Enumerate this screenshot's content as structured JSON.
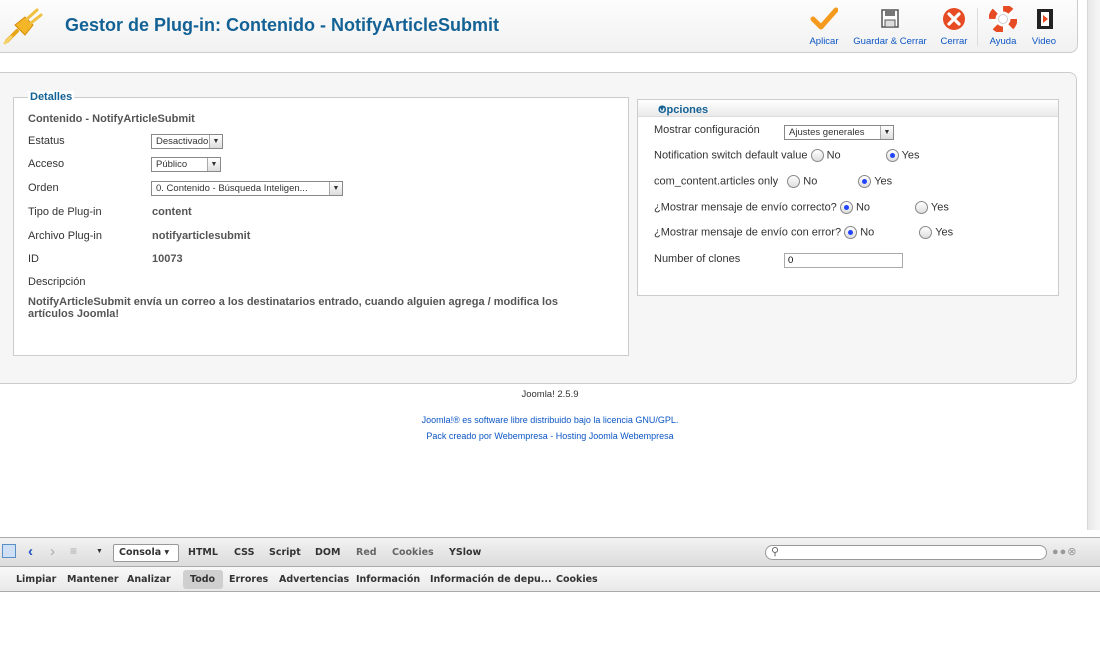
{
  "header": {
    "title": "Gestor de Plug-in: Contenido - NotifyArticleSubmit",
    "buttons": {
      "apply": "Aplicar",
      "save_close": "Guardar & Cerrar",
      "close": "Cerrar",
      "help": "Ayuda",
      "video": "Video"
    },
    "icons": {
      "logo": "plug-icon",
      "apply": "checkmark-icon",
      "save_close": "floppy-disk-icon",
      "close": "close-x-icon",
      "help": "lifebuoy-icon",
      "video": "film-icon"
    }
  },
  "details": {
    "legend": "Detalles",
    "subtitle": "Contenido - NotifyArticleSubmit",
    "status": {
      "label": "Estatus",
      "value": "Desactivado"
    },
    "access": {
      "label": "Acceso",
      "value": "Público"
    },
    "order": {
      "label": "Orden",
      "value": "0. Contenido - Búsqueda Inteligen..."
    },
    "type": {
      "label": "Tipo de Plug-in",
      "value": "content"
    },
    "file": {
      "label": "Archivo Plug-in",
      "value": "notifyarticlesubmit"
    },
    "id": {
      "label": "ID",
      "value": "10073"
    },
    "description": {
      "label": "Descripción",
      "value": "NotifyArticleSubmit envía un correo a los destinatarios entrado, cuando alguien agrega / modifica los artículos Joomla!"
    }
  },
  "options": {
    "title": "Opciones",
    "show_config": {
      "label": "Mostrar configuración",
      "value": "Ajustes generales"
    },
    "notif_switch": {
      "label": "Notification switch default value",
      "no": "No",
      "yes": "Yes",
      "selected": "yes"
    },
    "articles_only": {
      "label": "com_content.articles only",
      "no": "No",
      "yes": "Yes",
      "selected": "yes"
    },
    "msg_ok": {
      "label": "¿Mostrar mensaje de envío correcto?",
      "no": "No",
      "yes": "Yes",
      "selected": "no"
    },
    "msg_err": {
      "label": "¿Mostrar mensaje de envío con error?",
      "no": "No",
      "yes": "Yes",
      "selected": "no"
    },
    "clones": {
      "label": "Number of clones",
      "value": "0"
    }
  },
  "footer": {
    "version": "Joomla! 2.5.9",
    "license_link": "Joomla!®",
    "license_text": " es software libre distribuido bajo la licencia GNU/GPL.",
    "pack_text": "Pack creado por Webempresa - Hosting Joomla Webempresa"
  },
  "firebug": {
    "console_label": "Consola ▾",
    "tabs": [
      "HTML",
      "CSS",
      "Script",
      "DOM",
      "Red",
      "Cookies",
      "YSlow"
    ],
    "subtabs": [
      "Limpiar",
      "Mantener",
      "Analizar",
      "Todo",
      "Errores",
      "Advertencias",
      "Información",
      "Información de depu...",
      "Cookies"
    ],
    "search_placeholder": ""
  }
}
